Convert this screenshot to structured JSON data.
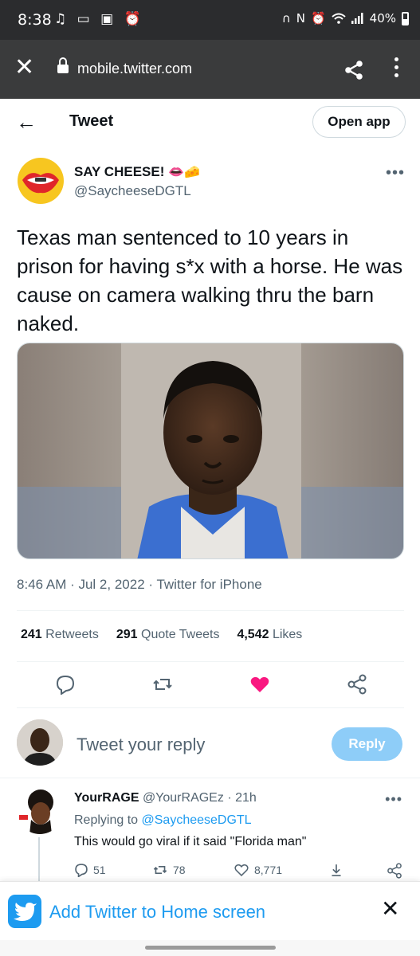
{
  "status_bar": {
    "time": "8:38",
    "left_icons": [
      "music-icon",
      "cast-icon",
      "image-icon",
      "alarm-off-icon"
    ],
    "right_icons": [
      "headset-icon",
      "nfc-icon",
      "alarm-icon",
      "wifi-icon",
      "signal-icon",
      "battery-icon"
    ],
    "battery_percent": "40%"
  },
  "browser": {
    "url": "mobile.twitter.com",
    "icons": [
      "close-icon",
      "lock-icon",
      "share-icon",
      "more-vertical-icon"
    ]
  },
  "header": {
    "title": "Tweet",
    "open_app_label": "Open app"
  },
  "tweet": {
    "author_name": "SAY CHEESE!",
    "author_emoji": "👄🧀",
    "author_handle": "@SaycheeseDGTL",
    "text": "Texas man sentenced to 10 years in prison for having s*x with a horse. He was cause on camera walking thru the barn naked.",
    "timestamp": "8:46 AM · Jul 2, 2022 · Twitter for iPhone",
    "stats": [
      {
        "count": "241",
        "label": "Retweets"
      },
      {
        "count": "291",
        "label": "Quote Tweets"
      },
      {
        "count": "4,542",
        "label": "Likes"
      }
    ],
    "liked": true,
    "colors": {
      "like": "#f91880",
      "link": "#1d9bf0"
    }
  },
  "reply_composer": {
    "placeholder": "Tweet your reply",
    "button_label": "Reply"
  },
  "reply": {
    "author_name": "YourRAGE",
    "author_handle": "@YourRAGEz",
    "time": "· 21h",
    "replying_prefix": "Replying to",
    "replying_to": "@SaycheeseDGTL",
    "text": "This would go viral if it said \"Florida man\"",
    "counts": {
      "replies": "51",
      "retweets": "78",
      "likes": "8,771"
    }
  },
  "banner": {
    "label": "Add Twitter to Home screen"
  }
}
